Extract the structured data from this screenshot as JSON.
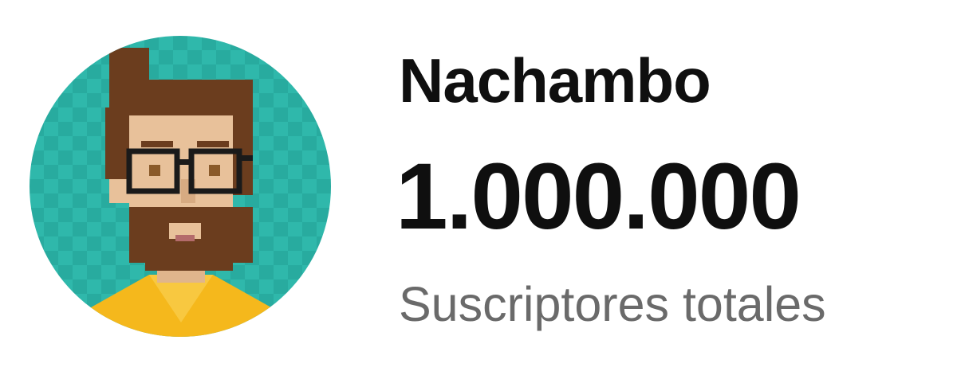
{
  "channel": {
    "name": "Nachambo",
    "subscriber_count": "1.000.000",
    "subscriber_label": "Suscriptores totales",
    "avatar_icon": "pixel-art-avatar-icon"
  },
  "colors": {
    "avatar_background": "#2bb5a8",
    "shirt": "#f5b81c",
    "hair_beard": "#6b3d1e",
    "skin": "#e8c19a",
    "text_primary": "#0f0f0f",
    "text_secondary": "#6a6a6a"
  }
}
